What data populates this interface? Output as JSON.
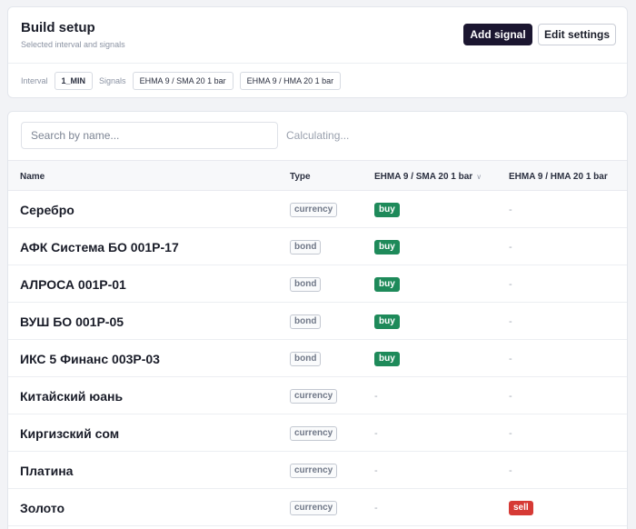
{
  "setup": {
    "title": "Build setup",
    "subtitle": "Selected interval and signals",
    "add_signal_label": "Add signal",
    "edit_settings_label": "Edit settings",
    "interval_label": "Interval",
    "interval_value": "1_MIN",
    "signals_label": "Signals",
    "signals": [
      "EHMA 9 / SMA 20 1 bar",
      "EHMA 9 / HMA 20 1 bar"
    ]
  },
  "search": {
    "placeholder": "Search by name...",
    "value": "",
    "status": "Calculating..."
  },
  "table": {
    "headers": {
      "name": "Name",
      "type": "Type",
      "signal1": "EHMA 9 / SMA 20 1 bar",
      "signal2": "EHMA 9 / HMA 20 1 bar"
    },
    "sort_indicator": "∨",
    "rows": [
      {
        "name": "Серебро",
        "type": "currency",
        "s1": "buy",
        "s2": "-"
      },
      {
        "name": "АФК Система БО 001P-17",
        "type": "bond",
        "s1": "buy",
        "s2": "-"
      },
      {
        "name": "АЛРОСА 001P-01",
        "type": "bond",
        "s1": "buy",
        "s2": "-"
      },
      {
        "name": "ВУШ БО 001P-05",
        "type": "bond",
        "s1": "buy",
        "s2": "-"
      },
      {
        "name": "ИКС 5 Финанс 003P-03",
        "type": "bond",
        "s1": "buy",
        "s2": "-"
      },
      {
        "name": "Китайский юань",
        "type": "currency",
        "s1": "-",
        "s2": "-"
      },
      {
        "name": "Киргизский сом",
        "type": "currency",
        "s1": "-",
        "s2": "-"
      },
      {
        "name": "Платина",
        "type": "currency",
        "s1": "-",
        "s2": "-"
      },
      {
        "name": "Золото",
        "type": "currency",
        "s1": "-",
        "s2": "sell"
      }
    ]
  },
  "colors": {
    "primary_button": "#1b1630",
    "buy": "#1e8a5a",
    "sell": "#d63a35"
  }
}
